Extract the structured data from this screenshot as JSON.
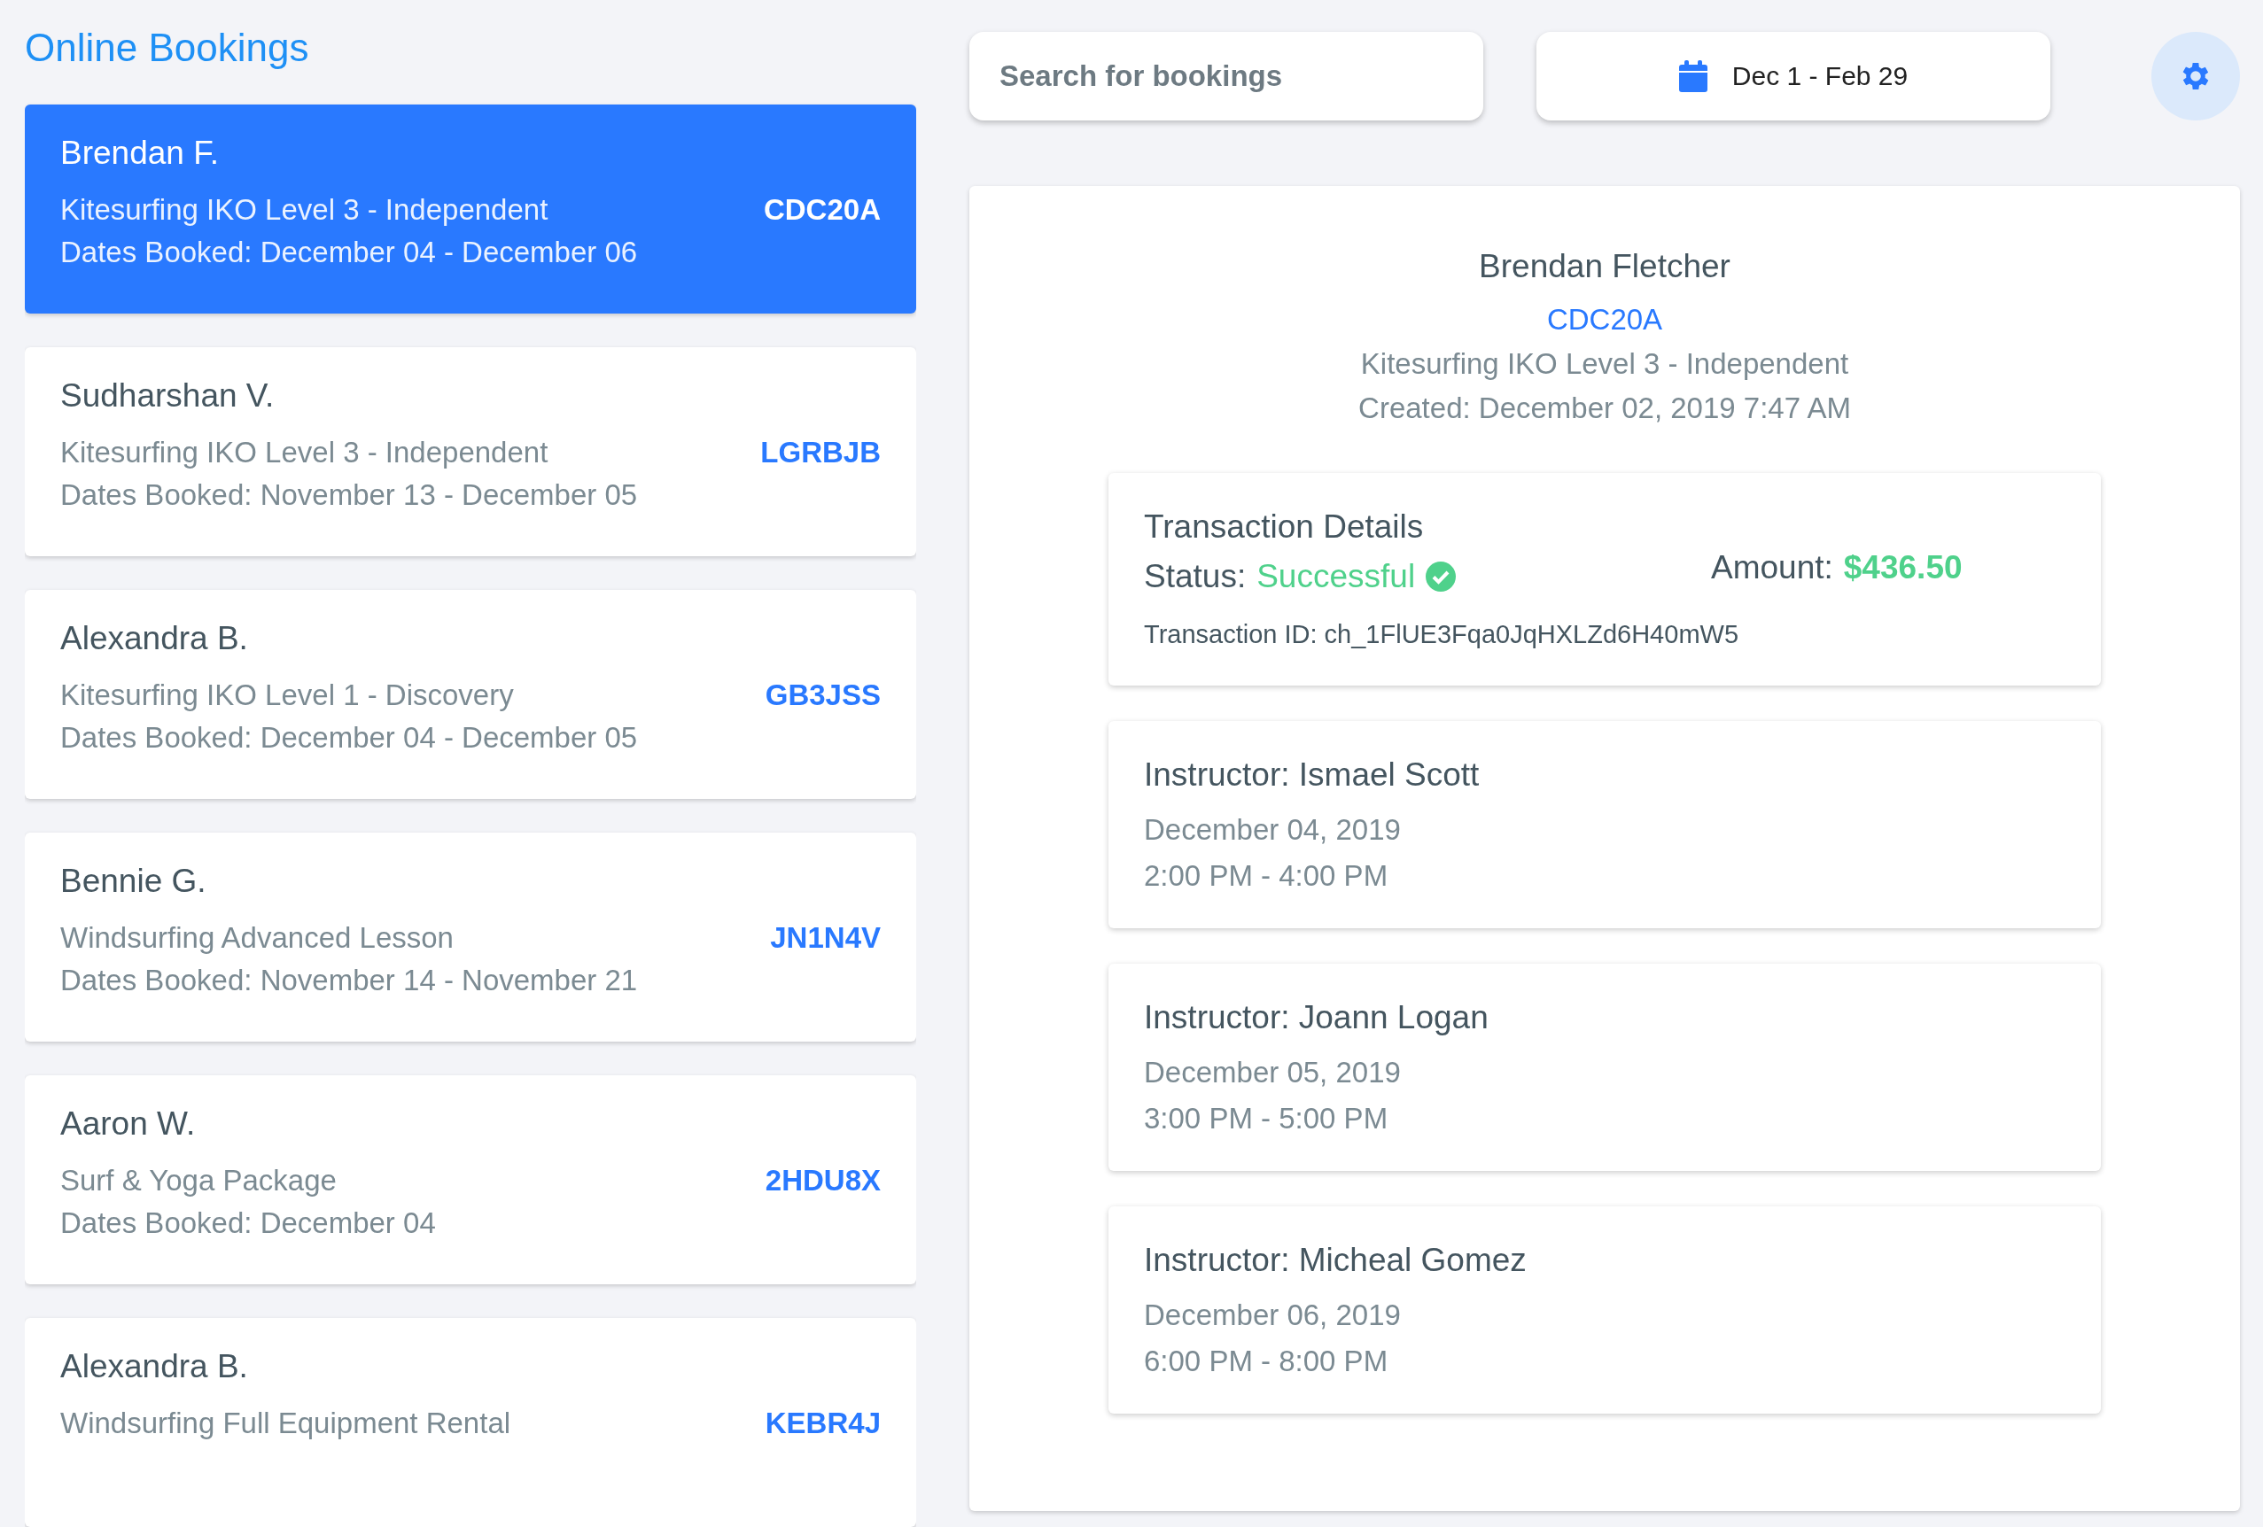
{
  "title": "Online Bookings",
  "search": {
    "placeholder": "Search for bookings"
  },
  "date_range": {
    "label": "Dec 1 - Feb 29"
  },
  "bookings": [
    {
      "name": "Brendan F.",
      "product": "Kitesurfing IKO Level 3 - Independent",
      "dates": "Dates Booked: December 04 - December 06",
      "code": "CDC20A",
      "selected": true
    },
    {
      "name": "Sudharshan V.",
      "product": "Kitesurfing IKO Level 3 - Independent",
      "dates": "Dates Booked: November 13 - December 05",
      "code": "LGRBJB",
      "selected": false
    },
    {
      "name": "Alexandra B.",
      "product": "Kitesurfing IKO Level 1 - Discovery",
      "dates": "Dates Booked: December 04 - December 05",
      "code": "GB3JSS",
      "selected": false
    },
    {
      "name": "Bennie G.",
      "product": "Windsurfing Advanced Lesson",
      "dates": "Dates Booked: November 14 - November 21",
      "code": "JN1N4V",
      "selected": false
    },
    {
      "name": "Aaron W.",
      "product": "Surf & Yoga Package",
      "dates": "Dates Booked: December 04",
      "code": "2HDU8X",
      "selected": false
    },
    {
      "name": "Alexandra B.",
      "product": "Windsurfing Full Equipment Rental",
      "code": "KEBR4J",
      "selected": false
    }
  ],
  "detail": {
    "name": "Brendan Fletcher",
    "code": "CDC20A",
    "product": "Kitesurfing IKO Level 3 - Independent",
    "created": "Created: December 02, 2019 7:47 AM",
    "transaction": {
      "title": "Transaction Details",
      "status_label": "Status:",
      "status": "Successful",
      "amount_label": "Amount:",
      "amount": "$436.50",
      "id": "Transaction ID: ch_1FlUE3Fqa0JqHXLZd6H40mW5"
    },
    "sessions": [
      {
        "instructor": "Instructor: Ismael Scott",
        "date": "December 04, 2019",
        "time": "2:00 PM - 4:00 PM"
      },
      {
        "instructor": "Instructor: Joann Logan",
        "date": "December 05, 2019",
        "time": "3:00 PM - 5:00 PM"
      },
      {
        "instructor": "Instructor: Micheal Gomez",
        "date": "December 06, 2019",
        "time": "6:00 PM - 8:00 PM"
      }
    ]
  }
}
